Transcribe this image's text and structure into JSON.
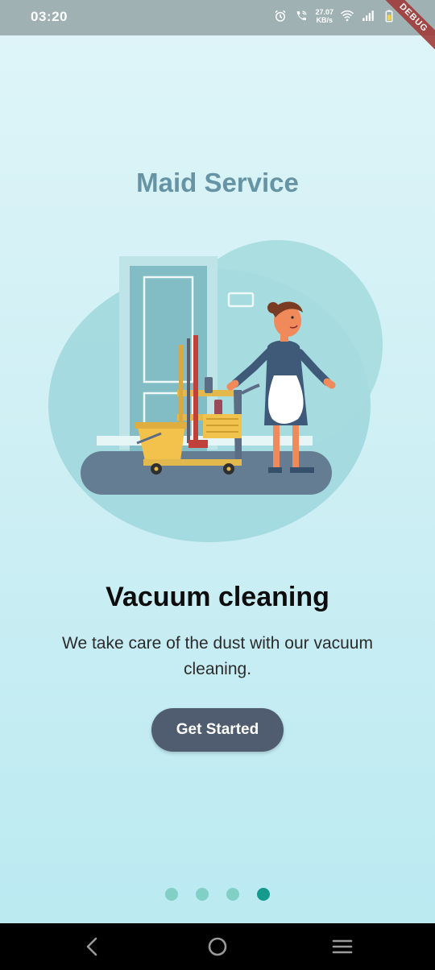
{
  "status_bar": {
    "time": "03:20",
    "net_speed_value": "27.07",
    "net_speed_unit": "KB/s",
    "icons": [
      "alarm-icon",
      "wifi-call-icon",
      "wifi-icon",
      "signal-icon",
      "battery-icon"
    ]
  },
  "debug_banner": "DEBUG",
  "app": {
    "title": "Maid Service"
  },
  "slide": {
    "heading": "Vacuum cleaning",
    "description": "We take care of the dust with our vacuum cleaning.",
    "button_label": "Get Started"
  },
  "page_indicator": {
    "count": 4,
    "active_index": 3
  },
  "colors": {
    "title": "#6694a4",
    "button_bg": "#505d70",
    "dot_inactive": "#82cfc6",
    "dot_active": "#159b8d",
    "status_bar_bg": "#9fb1b2"
  },
  "nav_bar": {
    "icons": [
      "back-icon",
      "home-icon",
      "recents-icon"
    ]
  }
}
